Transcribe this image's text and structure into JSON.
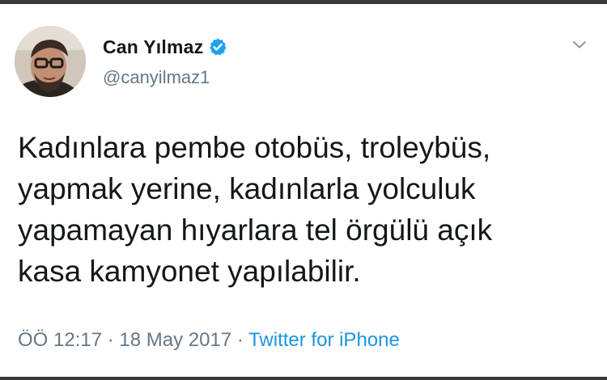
{
  "tweet": {
    "author": {
      "name": "Can Yılmaz",
      "handle": "@canyilmaz1",
      "verified_icon": "verified-badge-icon",
      "avatar_icon": "profile-photo"
    },
    "menu_icon": "chevron-down-icon",
    "text": "Kadınlara pembe otobüs, troleybüs,\nyapmak yerine, kadınlarla yolculuk\nyapamayan hıyarlara tel örgülü açık\nkasa kamyonet yapılabilir.",
    "time": "ÖÖ 12:17",
    "separator": "·",
    "date": "18 May 2017",
    "source": "Twitter for iPhone"
  },
  "colors": {
    "text": "#14171a",
    "secondary": "#657786",
    "link": "#1b95e0",
    "verified": "#1da1f2"
  }
}
